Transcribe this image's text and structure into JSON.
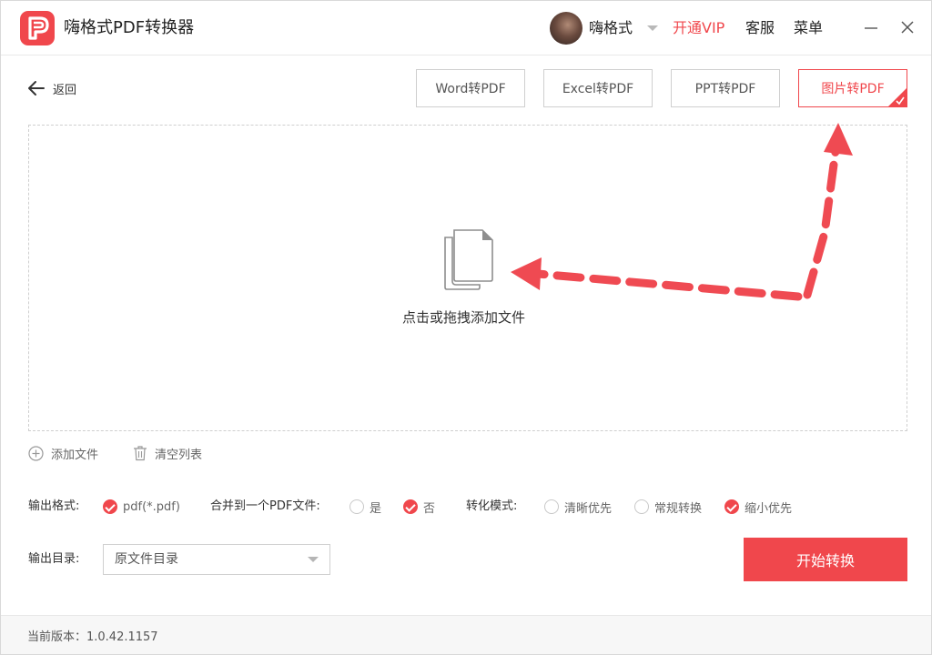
{
  "app": {
    "title": "嗨格式PDF转换器",
    "brand_color": "#f0474c",
    "logo_icon": "pdf-logo-icon"
  },
  "header": {
    "username": "嗨格式",
    "vip": "开通VIP",
    "service": "客服",
    "menu": "菜单"
  },
  "nav": {
    "back_label": "返回"
  },
  "tabs": [
    {
      "label": "Word转PDF",
      "active": false
    },
    {
      "label": "Excel转PDF",
      "active": false
    },
    {
      "label": "PPT转PDF",
      "active": false
    },
    {
      "label": "图片转PDF",
      "active": true
    }
  ],
  "dropzone": {
    "hint": "点击或拖拽添加文件",
    "icon": "file-copy-icon"
  },
  "file_actions": {
    "add": "添加文件",
    "clear": "清空列表"
  },
  "options": {
    "output_format_label": "输出格式:",
    "output_format_value": "pdf(*.pdf)",
    "merge_label": "合并到一个PDF文件:",
    "merge_yes": "是",
    "merge_no": "否",
    "mode_label": "转化模式:",
    "mode_clear": "清晰优先",
    "mode_normal": "常规转换",
    "mode_small": "缩小优先"
  },
  "output": {
    "dir_label": "输出目录:",
    "dir_value": "原文件目录",
    "start_button": "开始转换"
  },
  "footer": {
    "version": "当前版本：1.0.42.1157"
  }
}
